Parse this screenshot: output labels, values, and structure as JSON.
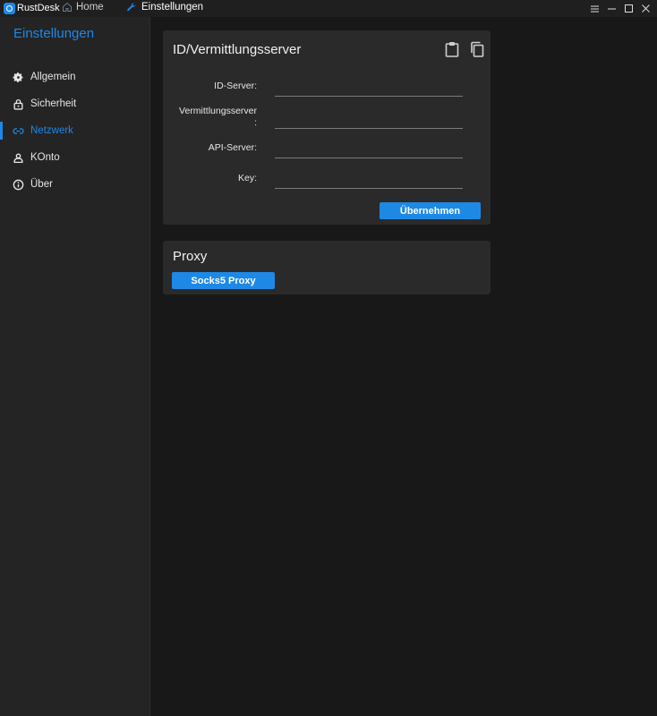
{
  "titlebar": {
    "app_name": "RustDesk",
    "tabs": [
      {
        "label": "Home",
        "icon": "home-icon"
      },
      {
        "label": "Einstellungen",
        "icon": "wrench-icon"
      }
    ],
    "controls": [
      "menu-icon",
      "minimize-icon",
      "maximize-icon",
      "close-icon"
    ]
  },
  "sidebar": {
    "title": "Einstellungen",
    "items": [
      {
        "label": "Allgemein",
        "icon": "gear-icon",
        "active": false
      },
      {
        "label": "Sicherheit",
        "icon": "lock-icon",
        "active": false
      },
      {
        "label": "Netzwerk",
        "icon": "link-icon",
        "active": true
      },
      {
        "label": "KOnto",
        "icon": "person-icon",
        "active": false
      },
      {
        "label": "Über",
        "icon": "info-icon",
        "active": false
      }
    ]
  },
  "server_card": {
    "title": "ID/Vermittlungsserver",
    "icons": [
      "clipboard-icon",
      "copy-icon"
    ],
    "fields": [
      {
        "label": "ID-Server:",
        "value": ""
      },
      {
        "label": "Vermittlungsserver\n:",
        "value": ""
      },
      {
        "label": "API-Server:",
        "value": ""
      },
      {
        "label": "Key:",
        "value": ""
      }
    ],
    "apply_label": "Übernehmen"
  },
  "proxy_card": {
    "title": "Proxy",
    "socks_label": "Socks5 Proxy"
  },
  "colors": {
    "accent": "#1e88e5",
    "background": "#181818",
    "sidebar": "#242424",
    "card": "#2a2a2a"
  }
}
